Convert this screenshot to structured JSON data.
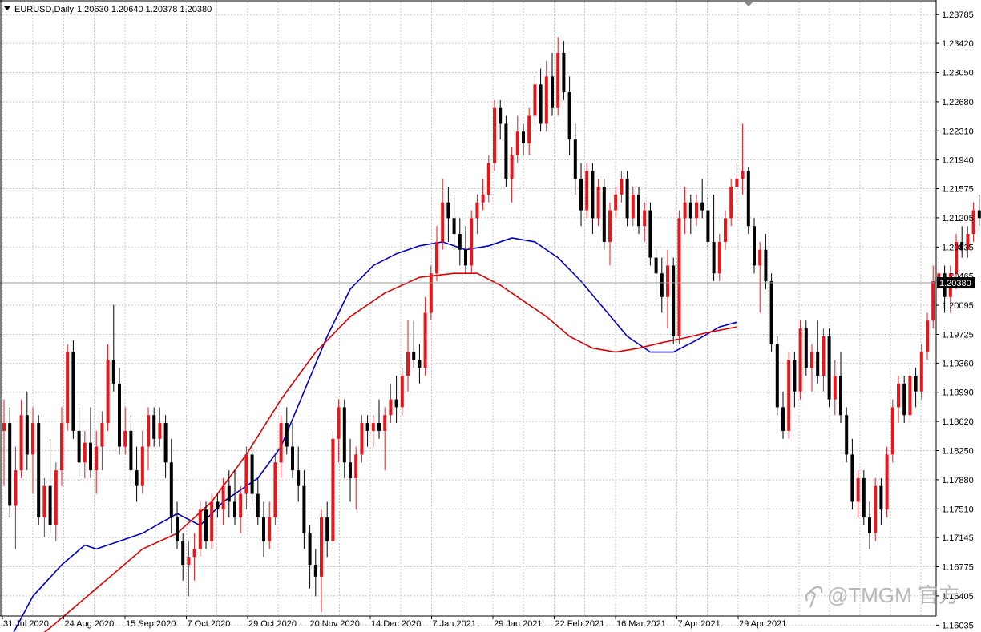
{
  "header": {
    "symbol": "EURUSD,Daily",
    "ohlc": "1.20630 1.20640 1.20378 1.20380"
  },
  "watermark": {
    "text": "@TMGM 官方",
    "icon": "tmgm-logo-icon"
  },
  "current_price_label": "1.20380",
  "colors": {
    "bull": "#e8151b",
    "bear": "#000000",
    "ma_blue": "#0000cc",
    "ma_red": "#e00000",
    "grid": "#c8c8c8",
    "price_tag_bg": "#000000"
  },
  "chart_data": {
    "type": "candlestick",
    "symbol": "EURUSD",
    "timeframe": "Daily",
    "ylim": [
      1.1615,
      1.2395
    ],
    "y_ticks": [
      "1.23785",
      "1.23420",
      "1.23050",
      "1.22680",
      "1.22310",
      "1.21940",
      "1.21575",
      "1.21205",
      "1.20835",
      "1.20465",
      "1.20095",
      "1.19725",
      "1.19360",
      "1.18990",
      "1.18620",
      "1.18250",
      "1.17880",
      "1.17510",
      "1.17145",
      "1.16775",
      "1.16405",
      "1.16035"
    ],
    "x_tick_labels": [
      "31 Jul 2020",
      "24 Aug 2020",
      "15 Sep 2020",
      "7 Oct 2020",
      "29 Oct 2020",
      "20 Nov 2020",
      "14 Dec 2020",
      "7 Jan 2021",
      "29 Jan 2021",
      "22 Feb 2021",
      "16 Mar 2021",
      "7 Apr 2021",
      "29 Apr 2021"
    ],
    "current_price": 1.2038,
    "candles": [
      [
        1.185,
        1.189,
        1.178,
        1.186
      ],
      [
        1.186,
        1.188,
        1.174,
        1.1755
      ],
      [
        1.1755,
        1.183,
        1.17,
        1.18
      ],
      [
        1.18,
        1.189,
        1.179,
        1.187
      ],
      [
        1.187,
        1.19,
        1.18,
        1.182
      ],
      [
        1.182,
        1.188,
        1.177,
        1.186
      ],
      [
        1.186,
        1.187,
        1.173,
        1.174
      ],
      [
        1.174,
        1.179,
        1.1715,
        1.178
      ],
      [
        1.178,
        1.184,
        1.172,
        1.173
      ],
      [
        1.173,
        1.181,
        1.171,
        1.18
      ],
      [
        1.18,
        1.188,
        1.178,
        1.186
      ],
      [
        1.186,
        1.196,
        1.185,
        1.195
      ],
      [
        1.195,
        1.1965,
        1.184,
        1.185
      ],
      [
        1.185,
        1.188,
        1.179,
        1.181
      ],
      [
        1.181,
        1.185,
        1.179,
        1.1835
      ],
      [
        1.1835,
        1.188,
        1.179,
        1.18
      ],
      [
        1.18,
        1.185,
        1.177,
        1.183
      ],
      [
        1.183,
        1.1875,
        1.18,
        1.186
      ],
      [
        1.186,
        1.196,
        1.185,
        1.194
      ],
      [
        1.194,
        1.201,
        1.19,
        1.191
      ],
      [
        1.191,
        1.193,
        1.182,
        1.183
      ],
      [
        1.183,
        1.188,
        1.182,
        1.185
      ],
      [
        1.185,
        1.187,
        1.178,
        1.18
      ],
      [
        1.18,
        1.183,
        1.176,
        1.178
      ],
      [
        1.178,
        1.185,
        1.177,
        1.183
      ],
      [
        1.183,
        1.188,
        1.18,
        1.187
      ],
      [
        1.187,
        1.188,
        1.183,
        1.184
      ],
      [
        1.184,
        1.188,
        1.183,
        1.186
      ],
      [
        1.186,
        1.187,
        1.179,
        1.181
      ],
      [
        1.181,
        1.184,
        1.172,
        1.174
      ],
      [
        1.174,
        1.176,
        1.17,
        1.171
      ],
      [
        1.171,
        1.172,
        1.166,
        1.168
      ],
      [
        1.168,
        1.171,
        1.164,
        1.169
      ],
      [
        1.169,
        1.172,
        1.166,
        1.17
      ],
      [
        1.17,
        1.176,
        1.169,
        1.175
      ],
      [
        1.175,
        1.176,
        1.17,
        1.171
      ],
      [
        1.171,
        1.177,
        1.17,
        1.176
      ],
      [
        1.176,
        1.177,
        1.174,
        1.175
      ],
      [
        1.175,
        1.179,
        1.173,
        1.178
      ],
      [
        1.178,
        1.18,
        1.174,
        1.176
      ],
      [
        1.176,
        1.18,
        1.173,
        1.174
      ],
      [
        1.174,
        1.178,
        1.172,
        1.177
      ],
      [
        1.177,
        1.183,
        1.175,
        1.182
      ],
      [
        1.182,
        1.184,
        1.176,
        1.177
      ],
      [
        1.177,
        1.179,
        1.173,
        1.174
      ],
      [
        1.174,
        1.176,
        1.169,
        1.171
      ],
      [
        1.171,
        1.176,
        1.17,
        1.174
      ],
      [
        1.174,
        1.182,
        1.173,
        1.181
      ],
      [
        1.181,
        1.187,
        1.179,
        1.186
      ],
      [
        1.186,
        1.188,
        1.182,
        1.183
      ],
      [
        1.183,
        1.186,
        1.179,
        1.18
      ],
      [
        1.18,
        1.183,
        1.176,
        1.178
      ],
      [
        1.178,
        1.18,
        1.17,
        1.172
      ],
      [
        1.172,
        1.173,
        1.165,
        1.168
      ],
      [
        1.168,
        1.17,
        1.164,
        1.1665
      ],
      [
        1.1665,
        1.175,
        1.162,
        1.174
      ],
      [
        1.174,
        1.176,
        1.169,
        1.171
      ],
      [
        1.171,
        1.185,
        1.17,
        1.184
      ],
      [
        1.184,
        1.189,
        1.181,
        1.188
      ],
      [
        1.188,
        1.189,
        1.179,
        1.181
      ],
      [
        1.181,
        1.184,
        1.176,
        1.179
      ],
      [
        1.179,
        1.183,
        1.175,
        1.182
      ],
      [
        1.182,
        1.187,
        1.181,
        1.186
      ],
      [
        1.186,
        1.187,
        1.183,
        1.185
      ],
      [
        1.185,
        1.187,
        1.183,
        1.186
      ],
      [
        1.186,
        1.189,
        1.184,
        1.185
      ],
      [
        1.185,
        1.188,
        1.18,
        1.187
      ],
      [
        1.187,
        1.191,
        1.186,
        1.189
      ],
      [
        1.189,
        1.192,
        1.186,
        1.188
      ],
      [
        1.188,
        1.193,
        1.187,
        1.192
      ],
      [
        1.192,
        1.199,
        1.19,
        1.195
      ],
      [
        1.195,
        1.199,
        1.193,
        1.194
      ],
      [
        1.194,
        1.196,
        1.191,
        1.193
      ],
      [
        1.193,
        1.202,
        1.192,
        1.2
      ],
      [
        1.2,
        1.206,
        1.199,
        1.205
      ],
      [
        1.205,
        1.211,
        1.204,
        1.209
      ],
      [
        1.209,
        1.217,
        1.208,
        1.214
      ],
      [
        1.214,
        1.216,
        1.209,
        1.212
      ],
      [
        1.212,
        1.215,
        1.208,
        1.21
      ],
      [
        1.21,
        1.212,
        1.206,
        1.208
      ],
      [
        1.208,
        1.211,
        1.205,
        1.206
      ],
      [
        1.206,
        1.213,
        1.205,
        1.212
      ],
      [
        1.212,
        1.215,
        1.21,
        1.214
      ],
      [
        1.214,
        1.217,
        1.213,
        1.215
      ],
      [
        1.215,
        1.22,
        1.214,
        1.219
      ],
      [
        1.219,
        1.227,
        1.218,
        1.226
      ],
      [
        1.226,
        1.227,
        1.222,
        1.224
      ],
      [
        1.224,
        1.225,
        1.216,
        1.217
      ],
      [
        1.217,
        1.221,
        1.214,
        1.22
      ],
      [
        1.22,
        1.225,
        1.219,
        1.223
      ],
      [
        1.223,
        1.224,
        1.22,
        1.2215
      ],
      [
        1.2215,
        1.226,
        1.22,
        1.225
      ],
      [
        1.225,
        1.23,
        1.224,
        1.229
      ],
      [
        1.229,
        1.231,
        1.223,
        1.224
      ],
      [
        1.224,
        1.232,
        1.223,
        1.23
      ],
      [
        1.23,
        1.233,
        1.225,
        1.226
      ],
      [
        1.226,
        1.235,
        1.225,
        1.233
      ],
      [
        1.233,
        1.2345,
        1.227,
        1.228
      ],
      [
        1.228,
        1.23,
        1.22,
        1.222
      ],
      [
        1.222,
        1.224,
        1.215,
        1.217
      ],
      [
        1.217,
        1.219,
        1.211,
        1.213
      ],
      [
        1.213,
        1.219,
        1.212,
        1.218
      ],
      [
        1.218,
        1.219,
        1.21,
        1.212
      ],
      [
        1.212,
        1.217,
        1.211,
        1.216
      ],
      [
        1.216,
        1.217,
        1.208,
        1.209
      ],
      [
        1.209,
        1.214,
        1.206,
        1.213
      ],
      [
        1.213,
        1.216,
        1.212,
        1.215
      ],
      [
        1.215,
        1.218,
        1.214,
        1.217
      ],
      [
        1.217,
        1.218,
        1.211,
        1.212
      ],
      [
        1.212,
        1.216,
        1.211,
        1.215
      ],
      [
        1.215,
        1.216,
        1.21,
        1.211
      ],
      [
        1.211,
        1.214,
        1.209,
        1.213
      ],
      [
        1.213,
        1.214,
        1.206,
        1.207
      ],
      [
        1.207,
        1.208,
        1.202,
        1.205
      ],
      [
        1.205,
        1.207,
        1.2,
        1.202
      ],
      [
        1.202,
        1.208,
        1.198,
        1.206
      ],
      [
        1.206,
        1.207,
        1.196,
        1.197
      ],
      [
        1.197,
        1.213,
        1.196,
        1.212
      ],
      [
        1.212,
        1.216,
        1.21,
        1.214
      ],
      [
        1.214,
        1.215,
        1.21,
        1.212
      ],
      [
        1.212,
        1.215,
        1.211,
        1.214
      ],
      [
        1.214,
        1.217,
        1.212,
        1.213
      ],
      [
        1.213,
        1.215,
        1.208,
        1.209
      ],
      [
        1.209,
        1.215,
        1.204,
        1.205
      ],
      [
        1.205,
        1.21,
        1.204,
        1.209
      ],
      [
        1.209,
        1.213,
        1.208,
        1.212
      ],
      [
        1.212,
        1.217,
        1.211,
        1.216
      ],
      [
        1.216,
        1.219,
        1.214,
        1.217
      ],
      [
        1.217,
        1.224,
        1.215,
        1.218
      ],
      [
        1.218,
        1.2185,
        1.21,
        1.211
      ],
      [
        1.211,
        1.212,
        1.205,
        1.206
      ],
      [
        1.206,
        1.209,
        1.2,
        1.208
      ],
      [
        1.208,
        1.21,
        1.203,
        1.204
      ],
      [
        1.204,
        1.205,
        1.195,
        1.196
      ],
      [
        1.196,
        1.197,
        1.187,
        1.188
      ],
      [
        1.188,
        1.19,
        1.184,
        1.185
      ],
      [
        1.185,
        1.195,
        1.184,
        1.194
      ],
      [
        1.194,
        1.195,
        1.188,
        1.19
      ],
      [
        1.19,
        1.199,
        1.189,
        1.198
      ],
      [
        1.198,
        1.199,
        1.192,
        1.193
      ],
      [
        1.193,
        1.196,
        1.19,
        1.195
      ],
      [
        1.195,
        1.199,
        1.191,
        1.192
      ],
      [
        1.192,
        1.198,
        1.19,
        1.197
      ],
      [
        1.197,
        1.198,
        1.188,
        1.189
      ],
      [
        1.189,
        1.194,
        1.187,
        1.192
      ],
      [
        1.192,
        1.195,
        1.186,
        1.187
      ],
      [
        1.187,
        1.188,
        1.181,
        1.182
      ],
      [
        1.182,
        1.184,
        1.175,
        1.176
      ],
      [
        1.176,
        1.18,
        1.174,
        1.179
      ],
      [
        1.179,
        1.18,
        1.173,
        1.174
      ],
      [
        1.174,
        1.176,
        1.17,
        1.172
      ],
      [
        1.172,
        1.179,
        1.171,
        1.178
      ],
      [
        1.178,
        1.179,
        1.173,
        1.175
      ],
      [
        1.175,
        1.183,
        1.174,
        1.182
      ],
      [
        1.182,
        1.189,
        1.181,
        1.188
      ],
      [
        1.188,
        1.192,
        1.186,
        1.191
      ],
      [
        1.191,
        1.192,
        1.186,
        1.187
      ],
      [
        1.187,
        1.193,
        1.186,
        1.192
      ],
      [
        1.192,
        1.193,
        1.188,
        1.19
      ],
      [
        1.19,
        1.196,
        1.189,
        1.195
      ],
      [
        1.195,
        1.2,
        1.194,
        1.199
      ],
      [
        1.199,
        1.206,
        1.198,
        1.204
      ],
      [
        1.204,
        1.207,
        1.202,
        1.205
      ],
      [
        1.205,
        1.206,
        1.2,
        1.202
      ],
      [
        1.202,
        1.206,
        1.2,
        1.205
      ],
      [
        1.205,
        1.21,
        1.203,
        1.209
      ],
      [
        1.209,
        1.211,
        1.207,
        1.208
      ],
      [
        1.208,
        1.211,
        1.207,
        1.21
      ],
      [
        1.21,
        1.214,
        1.209,
        1.213
      ],
      [
        1.213,
        1.215,
        1.211,
        1.212
      ],
      [
        1.212,
        1.213,
        1.201,
        1.203
      ],
      [
        1.203,
        1.207,
        1.201,
        1.2063
      ],
      [
        1.2063,
        1.2064,
        1.203,
        1.2038
      ]
    ],
    "ma_blue": [
      [
        1,
        1.1585
      ],
      [
        5,
        1.164
      ],
      [
        10,
        1.168
      ],
      [
        14,
        1.1705
      ],
      [
        16,
        1.17
      ],
      [
        20,
        1.171
      ],
      [
        24,
        1.172
      ],
      [
        30,
        1.1745
      ],
      [
        34,
        1.173
      ],
      [
        38,
        1.176
      ],
      [
        44,
        1.179
      ],
      [
        48,
        1.183
      ],
      [
        52,
        1.19
      ],
      [
        56,
        1.197
      ],
      [
        60,
        1.203
      ],
      [
        64,
        1.206
      ],
      [
        68,
        1.2075
      ],
      [
        72,
        1.2085
      ],
      [
        76,
        1.209
      ],
      [
        80,
        1.208
      ],
      [
        84,
        1.2085
      ],
      [
        88,
        1.2095
      ],
      [
        92,
        1.209
      ],
      [
        96,
        1.207
      ],
      [
        100,
        1.204
      ],
      [
        104,
        1.2005
      ],
      [
        108,
        1.197
      ],
      [
        112,
        1.195
      ],
      [
        116,
        1.195
      ],
      [
        120,
        1.1965
      ],
      [
        124,
        1.1982
      ],
      [
        127,
        1.1988
      ]
    ],
    "ma_red": [
      [
        1,
        1.156
      ],
      [
        8,
        1.16
      ],
      [
        16,
        1.165
      ],
      [
        24,
        1.17
      ],
      [
        30,
        1.172
      ],
      [
        36,
        1.176
      ],
      [
        42,
        1.182
      ],
      [
        48,
        1.189
      ],
      [
        54,
        1.195
      ],
      [
        60,
        1.1995
      ],
      [
        66,
        1.2025
      ],
      [
        72,
        1.2045
      ],
      [
        78,
        1.205
      ],
      [
        82,
        1.205
      ],
      [
        86,
        1.2035
      ],
      [
        90,
        1.2015
      ],
      [
        94,
        1.1995
      ],
      [
        98,
        1.197
      ],
      [
        102,
        1.1955
      ],
      [
        106,
        1.195
      ],
      [
        110,
        1.1955
      ],
      [
        114,
        1.1962
      ],
      [
        118,
        1.1968
      ],
      [
        122,
        1.1975
      ],
      [
        127,
        1.1982
      ]
    ]
  }
}
